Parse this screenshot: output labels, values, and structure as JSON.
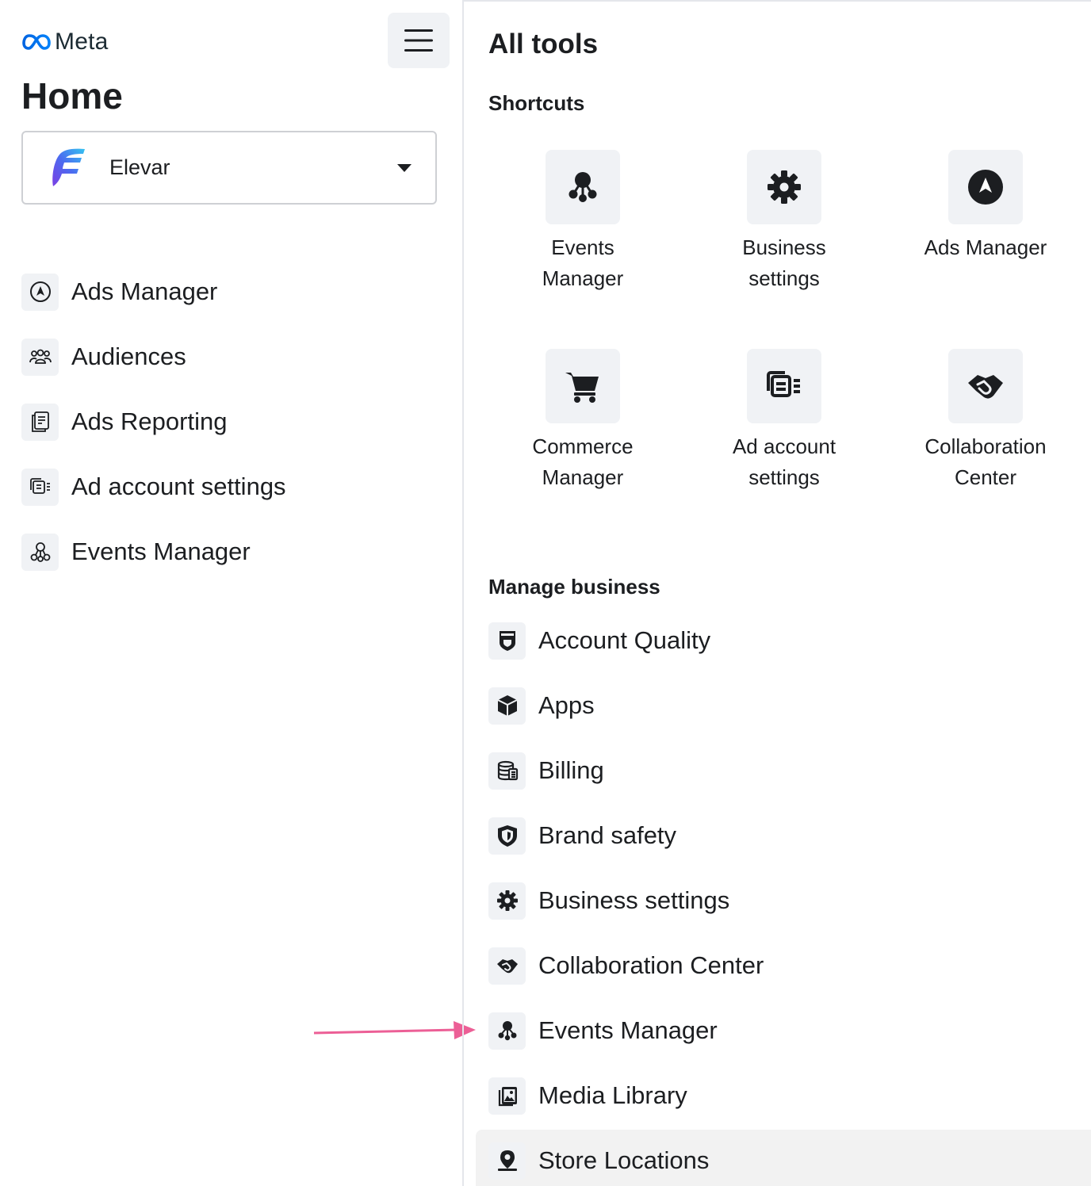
{
  "brand": {
    "logo_text": "Meta"
  },
  "page": {
    "title": "Home"
  },
  "account": {
    "name": "Elevar"
  },
  "sidebar": {
    "items": [
      {
        "label": "Ads Manager",
        "icon": "ads-manager-icon"
      },
      {
        "label": "Audiences",
        "icon": "audiences-icon"
      },
      {
        "label": "Ads Reporting",
        "icon": "ads-reporting-icon"
      },
      {
        "label": "Ad account settings",
        "icon": "ad-account-settings-icon"
      },
      {
        "label": "Events Manager",
        "icon": "events-manager-icon"
      }
    ]
  },
  "panel": {
    "title": "All tools",
    "shortcuts_title": "Shortcuts",
    "shortcuts": [
      {
        "label": "Events\nManager",
        "icon": "events-manager-icon"
      },
      {
        "label": "Business\nsettings",
        "icon": "gear-icon"
      },
      {
        "label": "Ads Manager",
        "icon": "ads-manager-icon"
      },
      {
        "label": "Commerce\nManager",
        "icon": "cart-icon"
      },
      {
        "label": "Ad account\nsettings",
        "icon": "ad-account-settings-icon"
      },
      {
        "label": "Collaboration\nCenter",
        "icon": "handshake-icon"
      }
    ],
    "manage_title": "Manage business",
    "manage_items": [
      {
        "label": "Account Quality",
        "icon": "account-quality-icon"
      },
      {
        "label": "Apps",
        "icon": "cube-icon"
      },
      {
        "label": "Billing",
        "icon": "billing-icon"
      },
      {
        "label": "Brand safety",
        "icon": "shield-icon"
      },
      {
        "label": "Business settings",
        "icon": "gear-icon"
      },
      {
        "label": "Collaboration Center",
        "icon": "handshake-icon"
      },
      {
        "label": "Events Manager",
        "icon": "events-manager-icon"
      },
      {
        "label": "Media Library",
        "icon": "media-library-icon"
      },
      {
        "label": "Store Locations",
        "icon": "location-pin-icon"
      }
    ]
  },
  "colors": {
    "annotation_arrow": "#ec5f96",
    "meta_blue": "#0668e1"
  }
}
